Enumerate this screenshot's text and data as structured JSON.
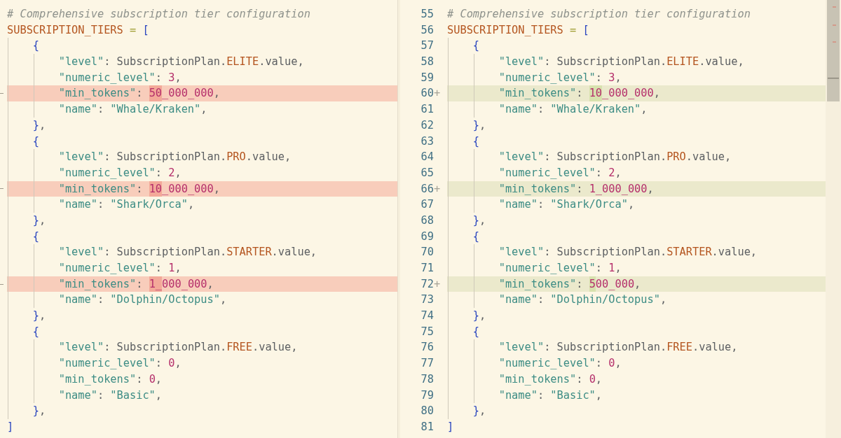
{
  "panes": [
    {
      "lines": [
        {
          "kind": "context",
          "tokens": [
            {
              "kind": "comment",
              "t": "# Comprehensive subscription tier configuration"
            }
          ]
        },
        {
          "kind": "context",
          "tokens": [
            {
              "kind": "id",
              "t": "SUBSCRIPTION_TIERS"
            },
            {
              "kind": "op",
              "t": " = "
            },
            {
              "kind": "br",
              "t": "["
            }
          ]
        },
        {
          "kind": "context",
          "tokens": [
            {
              "kind": "br",
              "t": "    {"
            }
          ]
        },
        {
          "kind": "context",
          "tokens": [
            {
              "kind": "key",
              "t": "        \"level\""
            },
            {
              "kind": "plain",
              "t": ": SubscriptionPlan."
            },
            {
              "kind": "const",
              "t": "ELITE"
            },
            {
              "kind": "plain",
              "t": ".value,"
            }
          ]
        },
        {
          "kind": "context",
          "tokens": [
            {
              "kind": "key",
              "t": "        \"numeric_level\""
            },
            {
              "kind": "plain",
              "t": ": "
            },
            {
              "kind": "num",
              "t": "3"
            },
            {
              "kind": "plain",
              "t": ","
            }
          ]
        },
        {
          "kind": "removed",
          "tokens": [
            {
              "kind": "key",
              "t": "        \"min_tokens\""
            },
            {
              "kind": "plain",
              "t": ": "
            },
            {
              "kind": "numhl",
              "t": "50"
            },
            {
              "kind": "num",
              "t": "_000_000"
            },
            {
              "kind": "plain",
              "t": ","
            }
          ]
        },
        {
          "kind": "context",
          "tokens": [
            {
              "kind": "key",
              "t": "        \"name\""
            },
            {
              "kind": "plain",
              "t": ": "
            },
            {
              "kind": "str",
              "t": "\"Whale/Kraken\""
            },
            {
              "kind": "plain",
              "t": ","
            }
          ]
        },
        {
          "kind": "context",
          "tokens": [
            {
              "kind": "br",
              "t": "    }"
            },
            {
              "kind": "plain",
              "t": ","
            }
          ]
        },
        {
          "kind": "context",
          "tokens": [
            {
              "kind": "br",
              "t": "    {"
            }
          ]
        },
        {
          "kind": "context",
          "tokens": [
            {
              "kind": "key",
              "t": "        \"level\""
            },
            {
              "kind": "plain",
              "t": ": SubscriptionPlan."
            },
            {
              "kind": "const",
              "t": "PRO"
            },
            {
              "kind": "plain",
              "t": ".value,"
            }
          ]
        },
        {
          "kind": "context",
          "tokens": [
            {
              "kind": "key",
              "t": "        \"numeric_level\""
            },
            {
              "kind": "plain",
              "t": ": "
            },
            {
              "kind": "num",
              "t": "2"
            },
            {
              "kind": "plain",
              "t": ","
            }
          ]
        },
        {
          "kind": "removed",
          "tokens": [
            {
              "kind": "key",
              "t": "        \"min_tokens\""
            },
            {
              "kind": "plain",
              "t": ": "
            },
            {
              "kind": "numhl",
              "t": "10"
            },
            {
              "kind": "num",
              "t": "_000_000"
            },
            {
              "kind": "plain",
              "t": ","
            }
          ]
        },
        {
          "kind": "context",
          "tokens": [
            {
              "kind": "key",
              "t": "        \"name\""
            },
            {
              "kind": "plain",
              "t": ": "
            },
            {
              "kind": "str",
              "t": "\"Shark/Orca\""
            },
            {
              "kind": "plain",
              "t": ","
            }
          ]
        },
        {
          "kind": "context",
          "tokens": [
            {
              "kind": "br",
              "t": "    }"
            },
            {
              "kind": "plain",
              "t": ","
            }
          ]
        },
        {
          "kind": "context",
          "tokens": [
            {
              "kind": "br",
              "t": "    {"
            }
          ]
        },
        {
          "kind": "context",
          "tokens": [
            {
              "kind": "key",
              "t": "        \"level\""
            },
            {
              "kind": "plain",
              "t": ": SubscriptionPlan."
            },
            {
              "kind": "const",
              "t": "STARTER"
            },
            {
              "kind": "plain",
              "t": ".value,"
            }
          ]
        },
        {
          "kind": "context",
          "tokens": [
            {
              "kind": "key",
              "t": "        \"numeric_level\""
            },
            {
              "kind": "plain",
              "t": ": "
            },
            {
              "kind": "num",
              "t": "1"
            },
            {
              "kind": "plain",
              "t": ","
            }
          ]
        },
        {
          "kind": "removed",
          "tokens": [
            {
              "kind": "key",
              "t": "        \"min_tokens\""
            },
            {
              "kind": "plain",
              "t": ": "
            },
            {
              "kind": "numhl",
              "t": "1_"
            },
            {
              "kind": "num",
              "t": "000_000"
            },
            {
              "kind": "plain",
              "t": ","
            }
          ]
        },
        {
          "kind": "context",
          "tokens": [
            {
              "kind": "key",
              "t": "        \"name\""
            },
            {
              "kind": "plain",
              "t": ": "
            },
            {
              "kind": "str",
              "t": "\"Dolphin/Octopus\""
            },
            {
              "kind": "plain",
              "t": ","
            }
          ]
        },
        {
          "kind": "context",
          "tokens": [
            {
              "kind": "br",
              "t": "    }"
            },
            {
              "kind": "plain",
              "t": ","
            }
          ]
        },
        {
          "kind": "context",
          "tokens": [
            {
              "kind": "br",
              "t": "    {"
            }
          ]
        },
        {
          "kind": "context",
          "tokens": [
            {
              "kind": "key",
              "t": "        \"level\""
            },
            {
              "kind": "plain",
              "t": ": SubscriptionPlan."
            },
            {
              "kind": "const",
              "t": "FREE"
            },
            {
              "kind": "plain",
              "t": ".value,"
            }
          ]
        },
        {
          "kind": "context",
          "tokens": [
            {
              "kind": "key",
              "t": "        \"numeric_level\""
            },
            {
              "kind": "plain",
              "t": ": "
            },
            {
              "kind": "num",
              "t": "0"
            },
            {
              "kind": "plain",
              "t": ","
            }
          ]
        },
        {
          "kind": "context",
          "tokens": [
            {
              "kind": "key",
              "t": "        \"min_tokens\""
            },
            {
              "kind": "plain",
              "t": ": "
            },
            {
              "kind": "num",
              "t": "0"
            },
            {
              "kind": "plain",
              "t": ","
            }
          ]
        },
        {
          "kind": "context",
          "tokens": [
            {
              "kind": "key",
              "t": "        \"name\""
            },
            {
              "kind": "plain",
              "t": ": "
            },
            {
              "kind": "str",
              "t": "\"Basic\""
            },
            {
              "kind": "plain",
              "t": ","
            }
          ]
        },
        {
          "kind": "context",
          "tokens": [
            {
              "kind": "br",
              "t": "    }"
            },
            {
              "kind": "plain",
              "t": ","
            }
          ]
        },
        {
          "kind": "context",
          "tokens": [
            {
              "kind": "br",
              "t": "]"
            }
          ]
        }
      ]
    },
    {
      "lines": [
        {
          "number": "55",
          "kind": "context",
          "tokens": [
            {
              "kind": "comment",
              "t": "# Comprehensive subscription tier configuration"
            }
          ]
        },
        {
          "number": "56",
          "kind": "context",
          "tokens": [
            {
              "kind": "id",
              "t": "SUBSCRIPTION_TIERS"
            },
            {
              "kind": "op",
              "t": " = "
            },
            {
              "kind": "br",
              "t": "["
            }
          ]
        },
        {
          "number": "57",
          "kind": "context",
          "tokens": [
            {
              "kind": "br",
              "t": "    {"
            }
          ]
        },
        {
          "number": "58",
          "kind": "context",
          "tokens": [
            {
              "kind": "key",
              "t": "        \"level\""
            },
            {
              "kind": "plain",
              "t": ": SubscriptionPlan."
            },
            {
              "kind": "const",
              "t": "ELITE"
            },
            {
              "kind": "plain",
              "t": ".value,"
            }
          ]
        },
        {
          "number": "59",
          "kind": "context",
          "tokens": [
            {
              "kind": "key",
              "t": "        \"numeric_level\""
            },
            {
              "kind": "plain",
              "t": ": "
            },
            {
              "kind": "num",
              "t": "3"
            },
            {
              "kind": "plain",
              "t": ","
            }
          ]
        },
        {
          "number": "60",
          "marker": "+",
          "kind": "added",
          "tokens": [
            {
              "kind": "key",
              "t": "        \"min_tokens\""
            },
            {
              "kind": "plain",
              "t": ": "
            },
            {
              "kind": "numhl",
              "t": "10"
            },
            {
              "kind": "num",
              "t": "_000_000"
            },
            {
              "kind": "plain",
              "t": ","
            }
          ]
        },
        {
          "number": "61",
          "kind": "context",
          "tokens": [
            {
              "kind": "key",
              "t": "        \"name\""
            },
            {
              "kind": "plain",
              "t": ": "
            },
            {
              "kind": "str",
              "t": "\"Whale/Kraken\""
            },
            {
              "kind": "plain",
              "t": ","
            }
          ]
        },
        {
          "number": "62",
          "kind": "context",
          "tokens": [
            {
              "kind": "br",
              "t": "    }"
            },
            {
              "kind": "plain",
              "t": ","
            }
          ]
        },
        {
          "number": "63",
          "kind": "context",
          "tokens": [
            {
              "kind": "br",
              "t": "    {"
            }
          ]
        },
        {
          "number": "64",
          "kind": "context",
          "tokens": [
            {
              "kind": "key",
              "t": "        \"level\""
            },
            {
              "kind": "plain",
              "t": ": SubscriptionPlan."
            },
            {
              "kind": "const",
              "t": "PRO"
            },
            {
              "kind": "plain",
              "t": ".value,"
            }
          ]
        },
        {
          "number": "65",
          "kind": "context",
          "tokens": [
            {
              "kind": "key",
              "t": "        \"numeric_level\""
            },
            {
              "kind": "plain",
              "t": ": "
            },
            {
              "kind": "num",
              "t": "2"
            },
            {
              "kind": "plain",
              "t": ","
            }
          ]
        },
        {
          "number": "66",
          "marker": "+",
          "kind": "added",
          "tokens": [
            {
              "kind": "key",
              "t": "        \"min_tokens\""
            },
            {
              "kind": "plain",
              "t": ": "
            },
            {
              "kind": "num",
              "t": "1_000_000"
            },
            {
              "kind": "plain",
              "t": ","
            }
          ]
        },
        {
          "number": "67",
          "kind": "context",
          "tokens": [
            {
              "kind": "key",
              "t": "        \"name\""
            },
            {
              "kind": "plain",
              "t": ": "
            },
            {
              "kind": "str",
              "t": "\"Shark/Orca\""
            },
            {
              "kind": "plain",
              "t": ","
            }
          ]
        },
        {
          "number": "68",
          "kind": "context",
          "tokens": [
            {
              "kind": "br",
              "t": "    }"
            },
            {
              "kind": "plain",
              "t": ","
            }
          ]
        },
        {
          "number": "69",
          "kind": "context",
          "tokens": [
            {
              "kind": "br",
              "t": "    {"
            }
          ]
        },
        {
          "number": "70",
          "kind": "context",
          "tokens": [
            {
              "kind": "key",
              "t": "        \"level\""
            },
            {
              "kind": "plain",
              "t": ": SubscriptionPlan."
            },
            {
              "kind": "const",
              "t": "STARTER"
            },
            {
              "kind": "plain",
              "t": ".value,"
            }
          ]
        },
        {
          "number": "71",
          "kind": "context",
          "tokens": [
            {
              "kind": "key",
              "t": "        \"numeric_level\""
            },
            {
              "kind": "plain",
              "t": ": "
            },
            {
              "kind": "num",
              "t": "1"
            },
            {
              "kind": "plain",
              "t": ","
            }
          ]
        },
        {
          "number": "72",
          "marker": "+",
          "kind": "added",
          "tokens": [
            {
              "kind": "key",
              "t": "        \"min_tokens\""
            },
            {
              "kind": "plain",
              "t": ": "
            },
            {
              "kind": "numhl",
              "t": "5"
            },
            {
              "kind": "num",
              "t": "00_000"
            },
            {
              "kind": "plain",
              "t": ","
            }
          ]
        },
        {
          "number": "73",
          "kind": "context",
          "tokens": [
            {
              "kind": "key",
              "t": "        \"name\""
            },
            {
              "kind": "plain",
              "t": ": "
            },
            {
              "kind": "str",
              "t": "\"Dolphin/Octopus\""
            },
            {
              "kind": "plain",
              "t": ","
            }
          ]
        },
        {
          "number": "74",
          "kind": "context",
          "tokens": [
            {
              "kind": "br",
              "t": "    }"
            },
            {
              "kind": "plain",
              "t": ","
            }
          ]
        },
        {
          "number": "75",
          "kind": "context",
          "tokens": [
            {
              "kind": "br",
              "t": "    {"
            }
          ]
        },
        {
          "number": "76",
          "kind": "context",
          "tokens": [
            {
              "kind": "key",
              "t": "        \"level\""
            },
            {
              "kind": "plain",
              "t": ": SubscriptionPlan."
            },
            {
              "kind": "const",
              "t": "FREE"
            },
            {
              "kind": "plain",
              "t": ".value,"
            }
          ]
        },
        {
          "number": "77",
          "kind": "context",
          "tokens": [
            {
              "kind": "key",
              "t": "        \"numeric_level\""
            },
            {
              "kind": "plain",
              "t": ": "
            },
            {
              "kind": "num",
              "t": "0"
            },
            {
              "kind": "plain",
              "t": ","
            }
          ]
        },
        {
          "number": "78",
          "kind": "context",
          "tokens": [
            {
              "kind": "key",
              "t": "        \"min_tokens\""
            },
            {
              "kind": "plain",
              "t": ": "
            },
            {
              "kind": "num",
              "t": "0"
            },
            {
              "kind": "plain",
              "t": ","
            }
          ]
        },
        {
          "number": "79",
          "kind": "context",
          "tokens": [
            {
              "kind": "key",
              "t": "        \"name\""
            },
            {
              "kind": "plain",
              "t": ": "
            },
            {
              "kind": "str",
              "t": "\"Basic\""
            },
            {
              "kind": "plain",
              "t": ","
            }
          ]
        },
        {
          "number": "80",
          "kind": "context",
          "tokens": [
            {
              "kind": "br",
              "t": "    }"
            },
            {
              "kind": "plain",
              "t": ","
            }
          ]
        },
        {
          "number": "81",
          "kind": "context",
          "tokens": [
            {
              "kind": "br",
              "t": "]"
            }
          ]
        }
      ]
    }
  ]
}
